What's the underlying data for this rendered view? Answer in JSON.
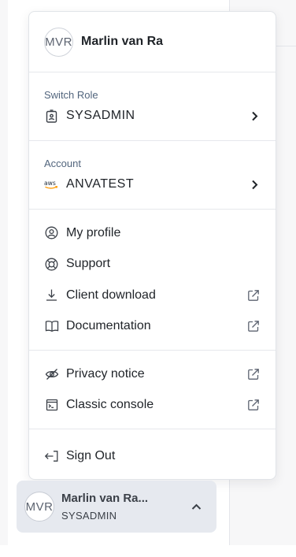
{
  "user": {
    "initials": "MVR",
    "name": "Marlin van Ra",
    "name_truncated": "Marlin van Ra...",
    "role": "SYSADMIN"
  },
  "switch_role": {
    "label": "Switch Role",
    "value": "SYSADMIN",
    "icon": "id-badge-icon"
  },
  "account": {
    "label": "Account",
    "value": "ANVATEST",
    "icon": "aws-logo-icon",
    "icon_text": "aws"
  },
  "menu_links": [
    {
      "label": "My profile",
      "icon": "user-circle-icon",
      "external": false
    },
    {
      "label": "Support",
      "icon": "lifebuoy-icon",
      "external": false
    },
    {
      "label": "Client download",
      "icon": "download-icon",
      "external": true
    },
    {
      "label": "Documentation",
      "icon": "book-icon",
      "external": true
    }
  ],
  "menu_links_2": [
    {
      "label": "Privacy notice",
      "icon": "eye-off-icon",
      "external": true
    },
    {
      "label": "Classic console",
      "icon": "terminal-icon",
      "external": true
    }
  ],
  "sign_out": {
    "label": "Sign Out",
    "icon": "sign-out-icon"
  },
  "colors": {
    "accent_label": "#52657d",
    "trigger_bg": "#e6e9ef"
  }
}
